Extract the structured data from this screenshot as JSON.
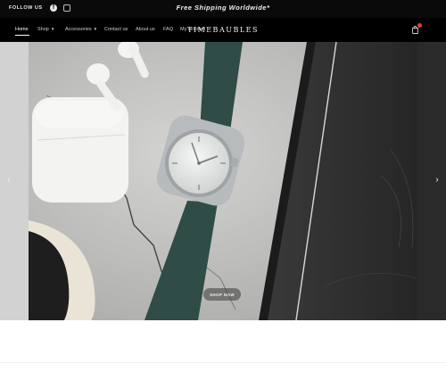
{
  "topbar": {
    "follow_label": "FOLLOW US",
    "announcement": "Free Shipping Worldwide*",
    "social": [
      {
        "icon": "facebook-icon"
      },
      {
        "icon": "instagram-icon"
      }
    ]
  },
  "nav": {
    "brand": "TIMEBAUBLES",
    "items": [
      {
        "label": "Home",
        "active": true
      },
      {
        "label": "Shop",
        "dropdown": true
      },
      {
        "label": "Accessories",
        "dropdown": true
      },
      {
        "label": "Contact us"
      },
      {
        "label": "About us"
      },
      {
        "label": "FAQ"
      },
      {
        "label": "My account"
      }
    ],
    "cart_icon": "shopping-bag-icon",
    "cart_badge_color": "#e0453a"
  },
  "hero": {
    "button_label": "SHOP NOW",
    "prev_icon": "chevron-left-icon",
    "next_icon": "chevron-right-icon"
  },
  "colors": {
    "bar_bg": "#0a0a0a",
    "strap": "#2e4a46",
    "dial": "#e9ece9",
    "concrete": "#c9c9c7"
  }
}
